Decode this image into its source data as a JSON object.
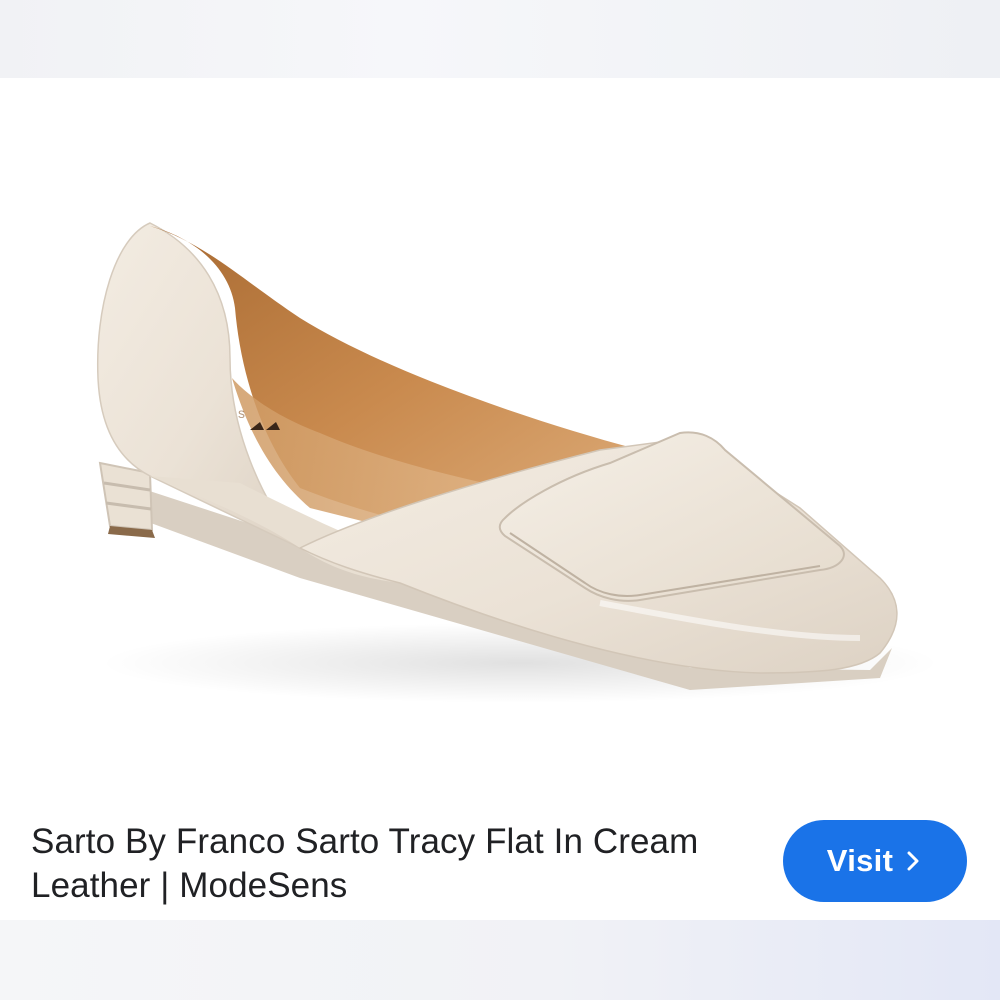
{
  "product": {
    "image_subject": "cream-leather-square-toe-flat",
    "title": "Sarto By Franco Sarto Tracy Flat In Cream Leather | ModeSens"
  },
  "actions": {
    "visit_label": "Visit",
    "visit_icon": "chevron-right-icon"
  },
  "colors": {
    "button": "#1a73e8",
    "button_text": "#ffffff",
    "title_text": "#202124",
    "shoe_leather": "#ede4d8",
    "shoe_lining": "#c98a4e"
  }
}
